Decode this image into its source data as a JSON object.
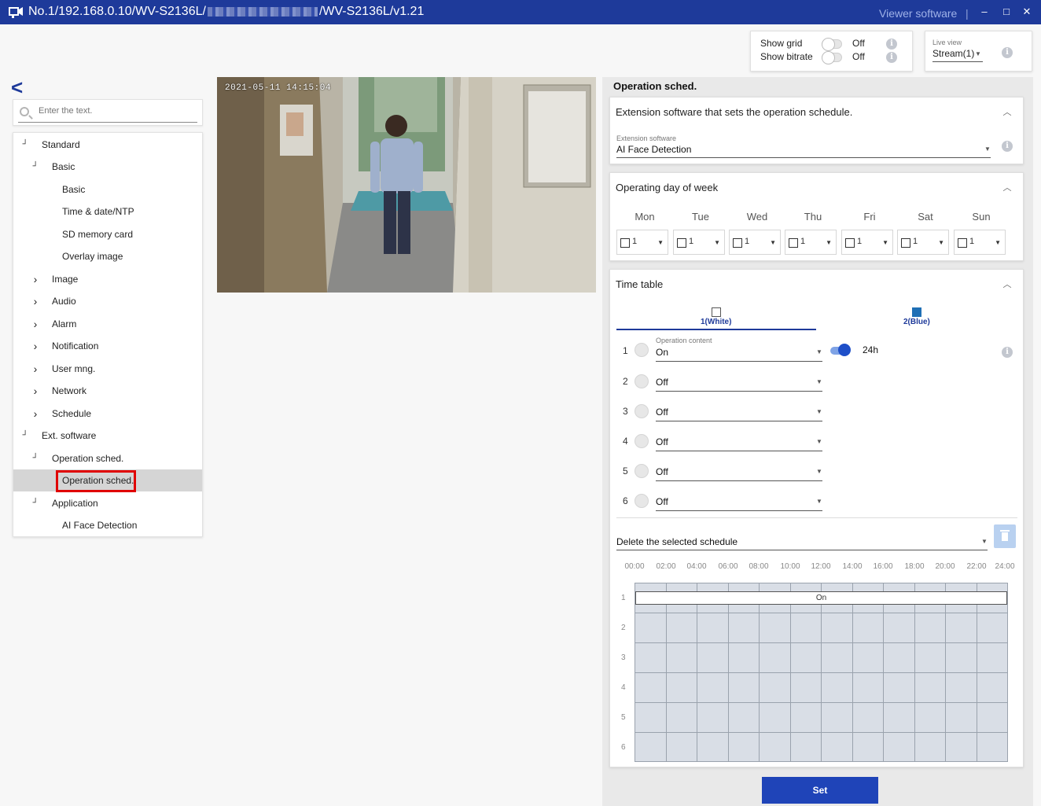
{
  "window": {
    "title_prefix": "No.1/192.168.0.10/WV-S2136L/",
    "title_suffix": "/WV-S2136L/v1.21",
    "viewer_software": "Viewer software",
    "separator": "|",
    "minimize": "–",
    "maximize": "□",
    "close": "✕"
  },
  "display_controls": {
    "show_grid_label": "Show grid",
    "show_grid_value": "Off",
    "show_bitrate_label": "Show bitrate",
    "show_bitrate_value": "Off",
    "live_view_label": "Live view",
    "live_view_value": "Stream(1)",
    "info": "i"
  },
  "sidebar": {
    "back": "<",
    "search_placeholder": "Enter the text.",
    "items": [
      {
        "label": "Standard",
        "arrow": "┘"
      },
      {
        "label": "Basic",
        "arrow": "┘"
      },
      {
        "label": "Basic",
        "arrow": ""
      },
      {
        "label": "Time & date/NTP",
        "arrow": ""
      },
      {
        "label": "SD memory card",
        "arrow": ""
      },
      {
        "label": "Overlay image",
        "arrow": ""
      },
      {
        "label": "Image",
        "arrow": "›"
      },
      {
        "label": "Audio",
        "arrow": "›"
      },
      {
        "label": "Alarm",
        "arrow": "›"
      },
      {
        "label": "Notification",
        "arrow": "›"
      },
      {
        "label": "User mng.",
        "arrow": "›"
      },
      {
        "label": "Network",
        "arrow": "›"
      },
      {
        "label": "Schedule",
        "arrow": "›"
      },
      {
        "label": "Ext. software",
        "arrow": "┘"
      },
      {
        "label": "Operation sched.",
        "arrow": "┘"
      },
      {
        "label": "Operation sched.",
        "arrow": ""
      },
      {
        "label": "Application",
        "arrow": "┘"
      },
      {
        "label": "AI Face Detection",
        "arrow": ""
      }
    ]
  },
  "camera": {
    "timestamp": "2021-05-11 14:15:04"
  },
  "panel": {
    "title": "Operation sched.",
    "ext_card": {
      "title": "Extension software that sets the operation schedule.",
      "field_label": "Extension software",
      "field_value": "AI Face Detection"
    },
    "days_card": {
      "title": "Operating day of week",
      "days": [
        "Mon",
        "Tue",
        "Wed",
        "Thu",
        "Fri",
        "Sat",
        "Sun"
      ],
      "values": [
        "1",
        "1",
        "1",
        "1",
        "1",
        "1",
        "1"
      ]
    },
    "time_card": {
      "title": "Time table",
      "tab1": "1(White)",
      "tab2": "2(Blue)",
      "tab2_color": "#1f6fb5",
      "content_label": "Operation content",
      "all_day": "24h",
      "rows": [
        {
          "num": "1",
          "value": "On"
        },
        {
          "num": "2",
          "value": "Off"
        },
        {
          "num": "3",
          "value": "Off"
        },
        {
          "num": "4",
          "value": "Off"
        },
        {
          "num": "5",
          "value": "Off"
        },
        {
          "num": "6",
          "value": "Off"
        }
      ],
      "delete_label": "Delete the selected schedule",
      "hours": [
        "00:00",
        "02:00",
        "04:00",
        "06:00",
        "08:00",
        "10:00",
        "12:00",
        "14:00",
        "16:00",
        "18:00",
        "20:00",
        "22:00",
        "24:00"
      ],
      "grid_rows": [
        "1",
        "2",
        "3",
        "4",
        "5",
        "6"
      ],
      "on_bar": "On"
    },
    "set_button": "Set"
  }
}
